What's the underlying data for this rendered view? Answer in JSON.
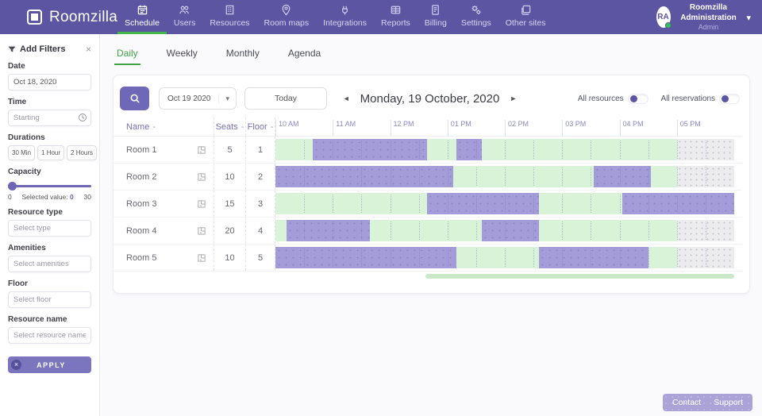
{
  "topbar": {
    "brand": "Roomzilla",
    "nav": [
      {
        "label": "Schedule",
        "icon": "icon-schedule",
        "active": true
      },
      {
        "label": "Users",
        "icon": "icon-users",
        "active": false
      },
      {
        "label": "Resources",
        "icon": "icon-resources",
        "active": false
      },
      {
        "label": "Room maps",
        "icon": "icon-room-maps",
        "active": false
      },
      {
        "label": "Integrations",
        "icon": "icon-integrations",
        "active": false
      },
      {
        "label": "Reports",
        "icon": "icon-reports",
        "active": false
      },
      {
        "label": "Billing",
        "icon": "icon-billing",
        "active": false
      },
      {
        "label": "Settings",
        "icon": "icon-settings",
        "active": false
      },
      {
        "label": "Other sites",
        "icon": "icon-other-sites",
        "active": false
      }
    ],
    "user": {
      "initials": "RA",
      "name": "Roomzilla Administration",
      "role": "Admin"
    }
  },
  "sidebar": {
    "title": "Add Filters",
    "date": {
      "label": "Date",
      "value": "Oct 18, 2020"
    },
    "time": {
      "label": "Time",
      "placeholder": "Starting"
    },
    "durations": {
      "label": "Durations",
      "options": [
        "30 Min",
        "1 Hour",
        "2 Hours"
      ]
    },
    "capacity": {
      "label": "Capacity",
      "min": "0",
      "max": "30",
      "selected_label": "Selected value:",
      "selected_value": "0"
    },
    "resource_type": {
      "label": "Resource type",
      "placeholder": "Select type"
    },
    "amenities": {
      "label": "Amenities",
      "placeholder": "Select amenities"
    },
    "floor": {
      "label": "Floor",
      "placeholder": "Select floor"
    },
    "resource_name": {
      "label": "Resource name",
      "placeholder": "Select resource name"
    },
    "apply_label": "APPLY"
  },
  "tabs": {
    "active_index": 0,
    "items": [
      "Daily",
      "Weekly",
      "Monthly",
      "Agenda"
    ]
  },
  "toolbar": {
    "date_select_value": "Oct 19 2020",
    "today_label": "Today",
    "current_date": "Monday, 19 October, 2020",
    "toggles": [
      {
        "label": "All resources",
        "state": "off"
      },
      {
        "label": "All reservations",
        "state": "off"
      }
    ]
  },
  "schedule": {
    "columns": {
      "name": "Name",
      "seats": "Seats",
      "floor": "Floor"
    },
    "sort_indicator": "-",
    "hours": [
      "10 AM",
      "11 AM",
      "12 PM",
      "01 PM",
      "02 PM",
      "03 PM",
      "04 PM",
      "05 PM"
    ],
    "timeline_span_hours": 8,
    "rows": [
      {
        "name": "Room 1",
        "seats": "5",
        "floor": "1",
        "segments": [
          {
            "type": "free",
            "start": 0,
            "end": 0.65
          },
          {
            "type": "busy",
            "start": 0.65,
            "end": 2.65
          },
          {
            "type": "free",
            "start": 2.65,
            "end": 3.15
          },
          {
            "type": "busy",
            "start": 3.15,
            "end": 3.6
          },
          {
            "type": "free",
            "start": 3.6,
            "end": 7
          },
          {
            "type": "closed",
            "start": 7,
            "end": 8
          }
        ]
      },
      {
        "name": "Room 2",
        "seats": "10",
        "floor": "2",
        "segments": [
          {
            "type": "busy",
            "start": 0,
            "end": 3.1
          },
          {
            "type": "free",
            "start": 3.1,
            "end": 5.55
          },
          {
            "type": "busy",
            "start": 5.55,
            "end": 6.55
          },
          {
            "type": "free",
            "start": 6.55,
            "end": 7
          },
          {
            "type": "closed",
            "start": 7,
            "end": 8
          }
        ]
      },
      {
        "name": "Room 3",
        "seats": "15",
        "floor": "3",
        "segments": [
          {
            "type": "free",
            "start": 0,
            "end": 2.65
          },
          {
            "type": "busy",
            "start": 2.65,
            "end": 4.6
          },
          {
            "type": "free",
            "start": 4.6,
            "end": 6.05
          },
          {
            "type": "busy",
            "start": 6.05,
            "end": 8
          }
        ]
      },
      {
        "name": "Room 4",
        "seats": "20",
        "floor": "4",
        "segments": [
          {
            "type": "free",
            "start": 0,
            "end": 0.2
          },
          {
            "type": "busy",
            "start": 0.2,
            "end": 1.65
          },
          {
            "type": "free",
            "start": 1.65,
            "end": 3.6
          },
          {
            "type": "busy",
            "start": 3.6,
            "end": 4.6
          },
          {
            "type": "free",
            "start": 4.6,
            "end": 7
          },
          {
            "type": "closed",
            "start": 7,
            "end": 8
          }
        ]
      },
      {
        "name": "Room 5",
        "seats": "10",
        "floor": "5",
        "segments": [
          {
            "type": "busy",
            "start": 0,
            "end": 3.15
          },
          {
            "type": "free",
            "start": 3.15,
            "end": 4.6
          },
          {
            "type": "busy",
            "start": 4.6,
            "end": 6.5
          },
          {
            "type": "free",
            "start": 6.5,
            "end": 7
          },
          {
            "type": "closed",
            "start": 7,
            "end": 8
          }
        ]
      }
    ],
    "h_scrollbar": {
      "thumb_start_pct": 18.7,
      "thumb_end_pct": 100
    }
  },
  "footer": {
    "contact": "Contact",
    "support": "Support"
  },
  "colors": {
    "topbar": "#5b55a2",
    "accent_green": "#43a047",
    "busy": "#a49bd9",
    "free": "#d9f3d8",
    "closed": "#ececee",
    "apply": "#7b74bf",
    "footer": "#aba3d7"
  }
}
